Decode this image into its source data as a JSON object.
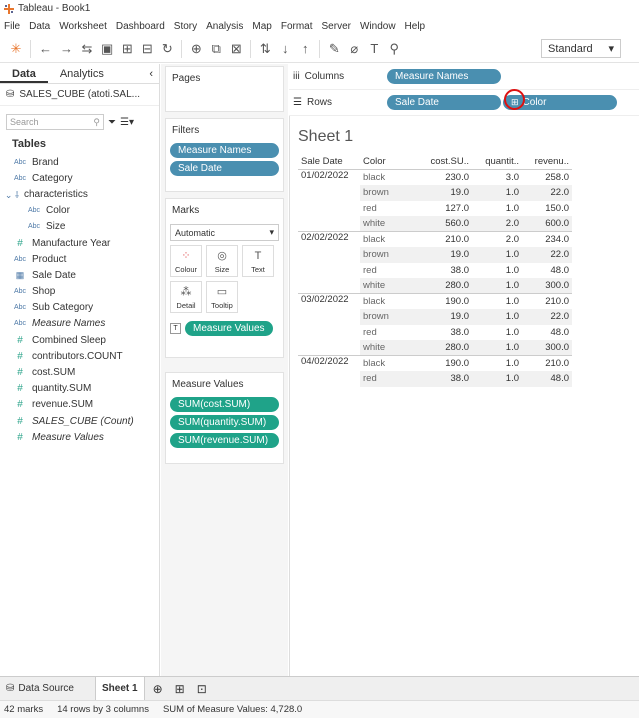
{
  "window": {
    "title": "Tableau - Book1"
  },
  "menu": [
    "File",
    "Data",
    "Worksheet",
    "Dashboard",
    "Story",
    "Analysis",
    "Map",
    "Format",
    "Server",
    "Window",
    "Help"
  ],
  "toolbar": {
    "view_mode": "Standard"
  },
  "left_pane": {
    "tabs": [
      "Data",
      "Analytics"
    ],
    "datasource": "SALES_CUBE (atoti.SAL...",
    "search_placeholder": "Search",
    "tables_heading": "Tables",
    "fields": [
      {
        "type": "Abc",
        "label": "Brand"
      },
      {
        "type": "Abc",
        "label": "Category"
      },
      {
        "type": "hier",
        "label": "characteristics"
      },
      {
        "type": "Abc",
        "label": "Color"
      },
      {
        "type": "Abc",
        "label": "Size"
      },
      {
        "type": "#",
        "label": "Manufacture Year"
      },
      {
        "type": "Abc",
        "label": "Product"
      },
      {
        "type": "date",
        "label": "Sale Date"
      },
      {
        "type": "Abc",
        "label": "Shop"
      },
      {
        "type": "Abc",
        "label": "Sub Category"
      },
      {
        "type": "Abc",
        "label": "Measure Names"
      },
      {
        "type": "#",
        "label": "Combined Sleep"
      },
      {
        "type": "#",
        "label": "contributors.COUNT"
      },
      {
        "type": "#",
        "label": "cost.SUM"
      },
      {
        "type": "#",
        "label": "quantity.SUM"
      },
      {
        "type": "#",
        "label": "revenue.SUM"
      },
      {
        "type": "#",
        "label": "SALES_CUBE (Count)"
      },
      {
        "type": "#",
        "label": "Measure Values"
      }
    ]
  },
  "cards": {
    "pages": "Pages",
    "filters_title": "Filters",
    "filters": [
      "Measure Names",
      "Sale Date"
    ],
    "marks_title": "Marks",
    "marks_type": "Automatic",
    "mark_buttons": [
      "Colour",
      "Size",
      "Text",
      "Detail",
      "Tooltip"
    ],
    "marks_pill": "Measure Values",
    "measure_values_title": "Measure Values",
    "measure_values": [
      "SUM(cost.SUM)",
      "SUM(quantity.SUM)",
      "SUM(revenue.SUM)"
    ]
  },
  "shelves": {
    "columns_label": "Columns",
    "rows_label": "Rows",
    "columns": [
      "Measure Names"
    ],
    "rows": [
      "Sale Date",
      "Color"
    ]
  },
  "sheet": {
    "title": "Sheet 1",
    "headers": [
      "Sale Date",
      "Color",
      "cost.SU..",
      "quantit..",
      "revenu.."
    ],
    "rows": [
      [
        "01/02/2022",
        "black",
        "230.0",
        "3.0",
        "258.0"
      ],
      [
        "",
        "brown",
        "19.0",
        "1.0",
        "22.0"
      ],
      [
        "",
        "red",
        "127.0",
        "1.0",
        "150.0"
      ],
      [
        "",
        "white",
        "560.0",
        "2.0",
        "600.0"
      ],
      [
        "02/02/2022",
        "black",
        "210.0",
        "2.0",
        "234.0"
      ],
      [
        "",
        "brown",
        "19.0",
        "1.0",
        "22.0"
      ],
      [
        "",
        "red",
        "38.0",
        "1.0",
        "48.0"
      ],
      [
        "",
        "white",
        "280.0",
        "1.0",
        "300.0"
      ],
      [
        "03/02/2022",
        "black",
        "190.0",
        "1.0",
        "210.0"
      ],
      [
        "",
        "brown",
        "19.0",
        "1.0",
        "22.0"
      ],
      [
        "",
        "red",
        "38.0",
        "1.0",
        "48.0"
      ],
      [
        "",
        "white",
        "280.0",
        "1.0",
        "300.0"
      ],
      [
        "04/02/2022",
        "black",
        "190.0",
        "1.0",
        "210.0"
      ],
      [
        "",
        "red",
        "38.0",
        "1.0",
        "48.0"
      ]
    ]
  },
  "bottom_tabs": {
    "datasource": "Data Source",
    "sheet": "Sheet 1"
  },
  "status": {
    "marks": "42 marks",
    "dims": "14 rows by 3 columns",
    "sum": "SUM of Measure Values: 4,728.0"
  },
  "colors": {
    "dim_pill": "#4a8fb0",
    "measure_pill": "#1fa389",
    "highlight": "#dd1111"
  }
}
